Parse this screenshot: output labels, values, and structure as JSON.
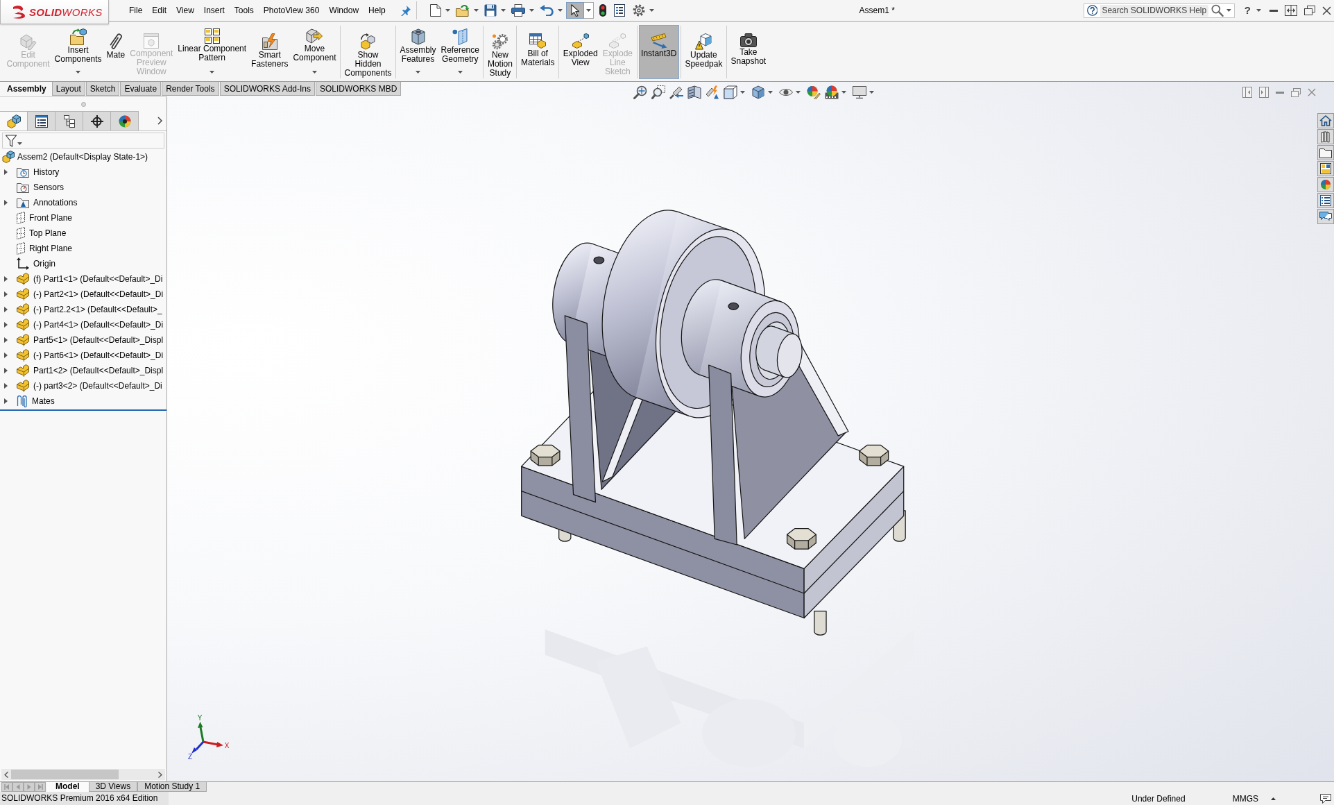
{
  "window": {
    "logo": "**SOLID**WORKS",
    "document_title": "Assem1 *"
  },
  "menu": [
    "File",
    "Edit",
    "View",
    "Insert",
    "Tools",
    "PhotoView 360",
    "Window",
    "Help"
  ],
  "quick_access": [
    {
      "kind": "new",
      "dropdown": true,
      "selected": false
    },
    {
      "kind": "open",
      "dropdown": true,
      "selected": false
    },
    {
      "kind": "save",
      "dropdown": true,
      "selected": false
    },
    {
      "kind": "print",
      "dropdown": true,
      "selected": false
    },
    {
      "kind": "undo",
      "dropdown": true,
      "selected": false
    },
    {
      "kind": "select",
      "dropdown": true,
      "selected": true
    },
    {
      "kind": "rebuild",
      "dropdown": false,
      "selected": false
    },
    {
      "kind": "file_properties",
      "dropdown": false,
      "selected": false
    },
    {
      "kind": "options",
      "dropdown": true,
      "selected": false
    }
  ],
  "help_search": {
    "placeholder": "Search SOLIDWORKS Help"
  },
  "help_button": {
    "label": "?",
    "dropdown": true
  },
  "command_manager": [
    [
      {
        "label": "Edit\nComponent",
        "kind": "edit_component",
        "disabled": true,
        "dropdown": false,
        "selected": false
      },
      {
        "label": "Insert\nComponents",
        "kind": "insert_components",
        "disabled": false,
        "dropdown": true,
        "selected": false
      },
      {
        "label": "Mate",
        "kind": "mate",
        "disabled": false,
        "dropdown": false,
        "selected": false
      },
      {
        "label": "Component\nPreview\nWindow",
        "kind": "component_preview_window",
        "disabled": true,
        "dropdown": false,
        "selected": false
      },
      {
        "label": "Linear Component\nPattern",
        "kind": "linear_component_pattern",
        "disabled": false,
        "dropdown": true,
        "selected": false
      },
      {
        "label": "Smart\nFasteners",
        "kind": "smart_fasteners",
        "disabled": false,
        "dropdown": false,
        "selected": false
      },
      {
        "label": "Move\nComponent",
        "kind": "move_component",
        "disabled": false,
        "dropdown": true,
        "selected": false
      }
    ],
    [
      {
        "label": "Show\nHidden\nComponents",
        "kind": "show_hidden_components",
        "disabled": false,
        "dropdown": false,
        "selected": false
      }
    ],
    [
      {
        "label": "Assembly\nFeatures",
        "kind": "assembly_features",
        "disabled": false,
        "dropdown": true,
        "selected": false
      },
      {
        "label": "Reference\nGeometry",
        "kind": "reference_geometry",
        "disabled": false,
        "dropdown": true,
        "selected": false
      }
    ],
    [
      {
        "label": "New\nMotion\nStudy",
        "kind": "new_motion_study",
        "disabled": false,
        "dropdown": false,
        "selected": false
      }
    ],
    [
      {
        "label": "Bill of\nMaterials",
        "kind": "bill_of_materials",
        "disabled": false,
        "dropdown": false,
        "selected": false
      }
    ],
    [
      {
        "label": "Exploded\nView",
        "kind": "exploded_view",
        "disabled": false,
        "dropdown": false,
        "selected": false
      },
      {
        "label": "Explode\nLine\nSketch",
        "kind": "explode_line_sketch",
        "disabled": true,
        "dropdown": false,
        "selected": false
      }
    ],
    [
      {
        "label": "Instant3D",
        "kind": "instant3d",
        "disabled": false,
        "dropdown": false,
        "selected": true
      }
    ],
    [
      {
        "label": "Update\nSpeedpak",
        "kind": "update_speedpak",
        "disabled": false,
        "dropdown": false,
        "selected": false
      }
    ],
    [
      {
        "label": "Take\nSnapshot",
        "kind": "take_snapshot",
        "disabled": false,
        "dropdown": false,
        "selected": false
      }
    ]
  ],
  "tabs": [
    {
      "label": "Assembly",
      "selected": true
    },
    {
      "label": "Layout",
      "selected": false
    },
    {
      "label": "Sketch",
      "selected": false
    },
    {
      "label": "Evaluate",
      "selected": false
    },
    {
      "label": "Render Tools",
      "selected": false
    },
    {
      "label": "SOLIDWORKS Add-Ins",
      "selected": false
    },
    {
      "label": "SOLIDWORKS MBD",
      "selected": false
    }
  ],
  "feature_manager": {
    "tabs": [
      {
        "kind": "feature_tree",
        "selected": true
      },
      {
        "kind": "property_manager",
        "selected": false
      },
      {
        "kind": "configuration_manager",
        "selected": false
      },
      {
        "kind": "dimxpert_manager",
        "selected": false
      },
      {
        "kind": "display_manager",
        "selected": false
      }
    ],
    "tree": {
      "label": "Assem2 (Default<Display State-1>)",
      "kind": "assembly",
      "children": [
        {
          "label": "History",
          "kind": "history",
          "expanded": false
        },
        {
          "label": "Sensors",
          "kind": "sensors"
        },
        {
          "label": "Annotations",
          "kind": "annotations",
          "expanded": false
        },
        {
          "label": "Front Plane",
          "kind": "plane"
        },
        {
          "label": "Top Plane",
          "kind": "plane"
        },
        {
          "label": "Right Plane",
          "kind": "plane"
        },
        {
          "label": "Origin",
          "kind": "origin"
        },
        {
          "label": "(f) Part1<1> (Default<<Default>_Di",
          "kind": "part",
          "expanded": false
        },
        {
          "label": "(-) Part2<1> (Default<<Default>_Di",
          "kind": "part",
          "expanded": false
        },
        {
          "label": "(-) Part2.2<1> (Default<<Default>_",
          "kind": "part",
          "expanded": false
        },
        {
          "label": "(-) Part4<1> (Default<<Default>_Di",
          "kind": "part",
          "expanded": false
        },
        {
          "label": "Part5<1> (Default<<Default>_Displ",
          "kind": "part",
          "expanded": false
        },
        {
          "label": "(-) Part6<1> (Default<<Default>_Di",
          "kind": "part",
          "expanded": false
        },
        {
          "label": "Part1<2> (Default<<Default>_Displ",
          "kind": "part",
          "expanded": false
        },
        {
          "label": "(-) part3<2> (Default<<Default>_Di",
          "kind": "part",
          "expanded": false
        },
        {
          "label": "Mates",
          "kind": "mates",
          "expanded": false
        }
      ]
    }
  },
  "triad": {
    "x": "X",
    "y": "Y",
    "z": "Z"
  },
  "bottom_tabs": [
    {
      "label": "Model",
      "selected": true
    },
    {
      "label": "3D Views",
      "selected": false
    },
    {
      "label": "Motion Study 1",
      "selected": false
    }
  ],
  "status_bar": {
    "edition": "SOLIDWORKS Premium 2016 x64 Edition",
    "state": "Under Defined",
    "units": "MMGS"
  }
}
